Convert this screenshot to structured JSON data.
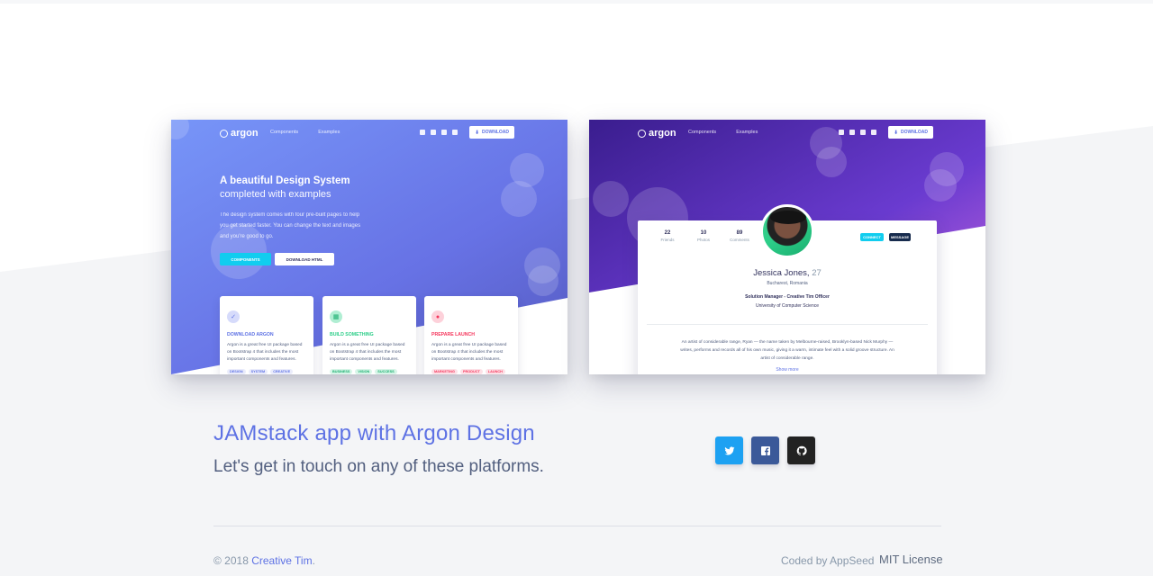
{
  "preview_left": {
    "brand": "argon",
    "nav_links": [
      "Components",
      "Examples"
    ],
    "download_label": "DOWNLOAD",
    "hero_title": "A beautiful Design System",
    "hero_subtitle": "completed with examples",
    "hero_text": "The design system comes with four pre-built pages to help you get started faster. You can change the text and images and you're good to go.",
    "btn_components": "COMPONENTS",
    "btn_download_html": "DOWNLOAD HTML",
    "features": [
      {
        "title": "DOWNLOAD ARGON",
        "text": "Argon is a great free UI package based on Bootstrap 4 that includes the most important components and features.",
        "tags": [
          "DESIGN",
          "SYSTEM",
          "CREATIVE"
        ],
        "color": "#5e72e4"
      },
      {
        "title": "BUILD SOMETHING",
        "text": "Argon is a great free UI package based on Bootstrap 4 that includes the most important components and features.",
        "tags": [
          "BUSINESS",
          "VISION",
          "SUCCESS"
        ],
        "color": "#2dce89"
      },
      {
        "title": "PREPARE LAUNCH",
        "text": "Argon is a great free UI package based on Bootstrap 4 that includes the most important components and features.",
        "tags": [
          "MARKETING",
          "PRODUCT",
          "LAUNCH"
        ],
        "color": "#f5365c"
      }
    ]
  },
  "preview_right": {
    "brand": "argon",
    "nav_links": [
      "Components",
      "Examples"
    ],
    "download_label": "DOWNLOAD",
    "stats": [
      {
        "value": "22",
        "label": "Friends"
      },
      {
        "value": "10",
        "label": "Photos"
      },
      {
        "value": "89",
        "label": "Comments"
      }
    ],
    "btn_connect": "CONNECT",
    "btn_message": "MESSAGE",
    "name": "Jessica Jones,",
    "age": "27",
    "location": "Bucharest, Romania",
    "job": "Solution Manager - Creative Tim Officer",
    "university": "University of Computer Science",
    "bio": "An artist of considerable range, Ryan — the name taken by Melbourne-raised, Brooklyn-based Nick Murphy — writes, performs and records all of his own music, giving it a warm, intimate feel with a solid groove structure. An artist of considerable range.",
    "show_more": "Show more"
  },
  "heading": "JAMstack app with Argon Design",
  "subheading": "Let's get in touch on any of these platforms.",
  "social": [
    {
      "name": "twitter-icon",
      "color": "#1da1f2"
    },
    {
      "name": "facebook-icon",
      "color": "#3b5999"
    },
    {
      "name": "github-icon",
      "color": "#222222"
    }
  ],
  "footer": {
    "copyright_prefix": "© 2018",
    "copyright_link": "Creative Tim",
    "copyright_suffix": ".",
    "coded_by": "Coded by AppSeed",
    "license": "MIT License"
  }
}
